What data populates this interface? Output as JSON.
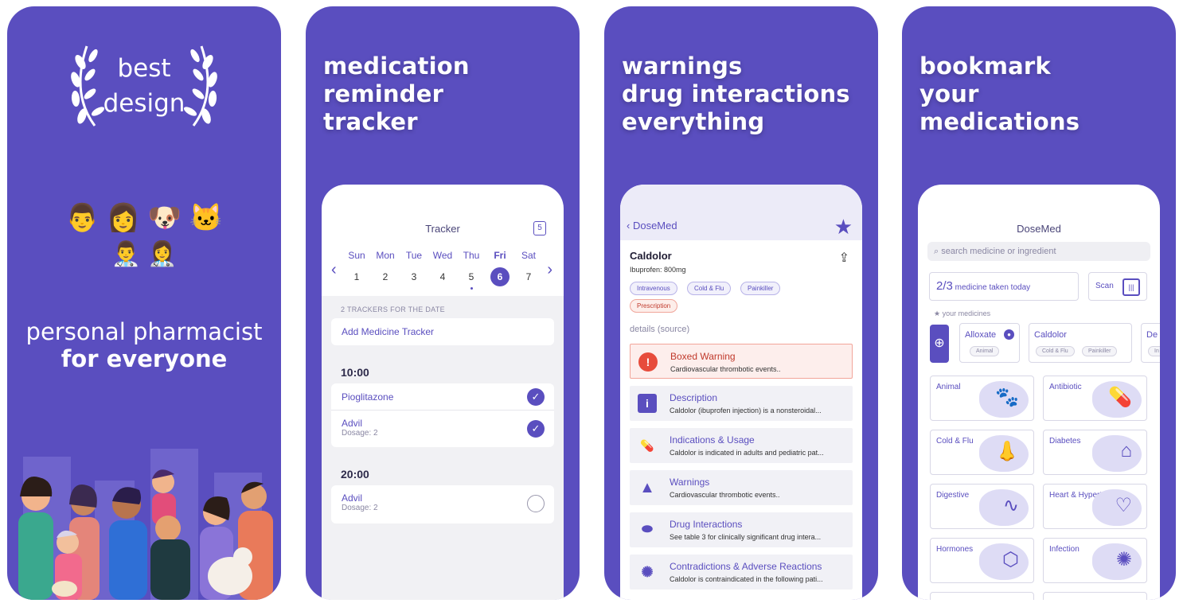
{
  "panel1": {
    "award_line1": "best",
    "award_line2": "design",
    "emoji_row1": "👨 👩 🐶 🐱",
    "emoji_row2": "👨‍⚕️ 👩‍⚕️",
    "tagline_line1": "personal pharmacist",
    "tagline_line2": "for everyone"
  },
  "panel2": {
    "headline": [
      "medication",
      "reminder",
      "tracker"
    ],
    "title": "Tracker",
    "calendar_badge": "5",
    "days": [
      {
        "name": "Sun",
        "num": "1"
      },
      {
        "name": "Mon",
        "num": "2"
      },
      {
        "name": "Tue",
        "num": "3"
      },
      {
        "name": "Wed",
        "num": "4"
      },
      {
        "name": "Thu",
        "num": "5"
      },
      {
        "name": "Fri",
        "num": "6"
      },
      {
        "name": "Sat",
        "num": "7"
      }
    ],
    "trackers_label": "2 TRACKERS FOR THE DATE",
    "add_tracker": "Add Medicine Tracker",
    "slot1_time": "10:00",
    "slot1_items": [
      {
        "name": "Pioglitazone",
        "dosage": ""
      },
      {
        "name": "Advil",
        "dosage": "Dosage: 2"
      }
    ],
    "slot2_time": "20:00",
    "slot2_items": [
      {
        "name": "Advil",
        "dosage": "Dosage: 2"
      }
    ]
  },
  "panel3": {
    "headline": [
      "warnings",
      "drug interactions",
      "everything"
    ],
    "back_label": "DoseMed",
    "drug_name": "Caldolor",
    "drug_sub": "Ibuprofen: 800mg",
    "chips": [
      "Intravenous",
      "Cold & Flu",
      "Painkiller",
      "Prescription"
    ],
    "details_label": "details  (source)",
    "sections": [
      {
        "title": "Boxed Warning",
        "desc": "Cardiovascular thrombotic events.."
      },
      {
        "title": "Description",
        "desc": "Caldolor (ibuprofen injection) is a nonsteroidal..."
      },
      {
        "title": "Indications & Usage",
        "desc": "Caldolor is indicated in adults and pediatric pat..."
      },
      {
        "title": "Warnings",
        "desc": "Cardiovascular thrombotic events.."
      },
      {
        "title": "Drug Interactions",
        "desc": "See table 3 for clinically significant drug intera..."
      },
      {
        "title": "Contradictions & Adverse Reactions",
        "desc": "Caldolor is contraindicated in the following pati..."
      }
    ]
  },
  "panel4": {
    "headline": [
      "bookmark",
      "your",
      "medications"
    ],
    "title": "DoseMed",
    "search_placeholder": "search medicine or ingredient",
    "taken_count": "2/3",
    "taken_label": "medicine taken today",
    "scan_label": "Scan",
    "your_medicines": "★ your medicines",
    "meds": [
      {
        "name": "Alloxate",
        "chips": [
          "Animal"
        ]
      },
      {
        "name": "Caldolor",
        "chips": [
          "Cold & Flu",
          "Painkiller"
        ]
      },
      {
        "name": "De",
        "chips": [
          "In"
        ]
      }
    ],
    "categories": [
      "Animal",
      "Antibiotic",
      "Cold & Flu",
      "Diabetes",
      "Digestive",
      "Heart & Hypertension",
      "Hormones",
      "Infection"
    ]
  },
  "colors": {
    "brand": "#5a4ebf",
    "warning": "#c0392b"
  }
}
